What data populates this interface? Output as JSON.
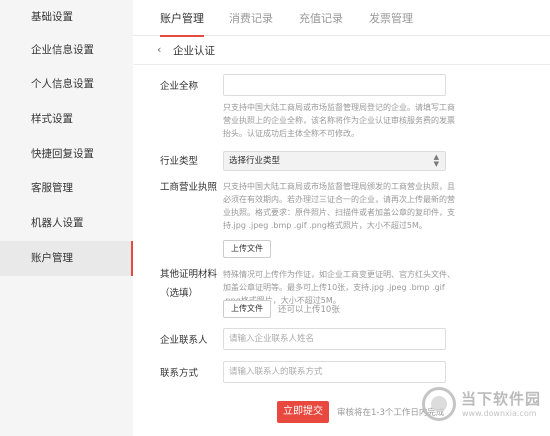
{
  "sidebar": {
    "items": [
      {
        "label": "基础设置"
      },
      {
        "label": "企业信息设置"
      },
      {
        "label": "个人信息设置"
      },
      {
        "label": "样式设置"
      },
      {
        "label": "快捷回复设置"
      },
      {
        "label": "客服管理"
      },
      {
        "label": "机器人设置"
      },
      {
        "label": "账户管理",
        "active": true
      }
    ]
  },
  "tabs": [
    {
      "label": "账户管理",
      "active": true
    },
    {
      "label": "消费记录"
    },
    {
      "label": "充值记录"
    },
    {
      "label": "发票管理"
    }
  ],
  "page": {
    "back_icon": "chevron-left-icon",
    "back_glyph": "‹",
    "title": "企业认证"
  },
  "form": {
    "company_name": {
      "label": "企业全称",
      "value": "",
      "hint": "只支持中国大陆工商局或市场监督管理局登记的企业。请填写工商营业执照上的企业全称，该名称将作为企业认证审核服务费的发票抬头。认证成功后主体全称不可修改。"
    },
    "industry": {
      "label": "行业类型",
      "selected": "选择行业类型",
      "arrow_icon": "sort-arrows-icon"
    },
    "license": {
      "label": "工商营业执照",
      "hint": "只支持中国大陆工商局或市场监督管理局颁发的工商营业执照，且必须在有效期内。若办理过三证合一的企业，请再次上传最新的营业执照。格式要求：原件照片、扫描件或者加盖公章的复印件，支持.jpg .jpeg .bmp .gif .png格式照片，大小不超过5M。",
      "upload_label": "上传文件"
    },
    "other": {
      "label_line1": "其他证明材料",
      "label_line2": "（选填）",
      "hint": "特殊情况可上传作为作证，如企业工商变更证明、官方红头文件、加盖公章证明等。最多可上传10张，支持.jpg .jpeg .bmp .gif .png格式照片，大小不超过5M。",
      "upload_label": "上传文件",
      "upload_note": "还可以上传10张"
    },
    "contact_person": {
      "label": "企业联系人",
      "placeholder": "请输入企业联系人姓名"
    },
    "contact_method": {
      "label": "联系方式",
      "placeholder": "请输入联系人的联系方式"
    },
    "submit_label": "立即提交",
    "submit_note": "审核将在1-3个工作日内完成"
  },
  "watermark": {
    "name": "当下软件园",
    "url": "www.downxia.com"
  }
}
